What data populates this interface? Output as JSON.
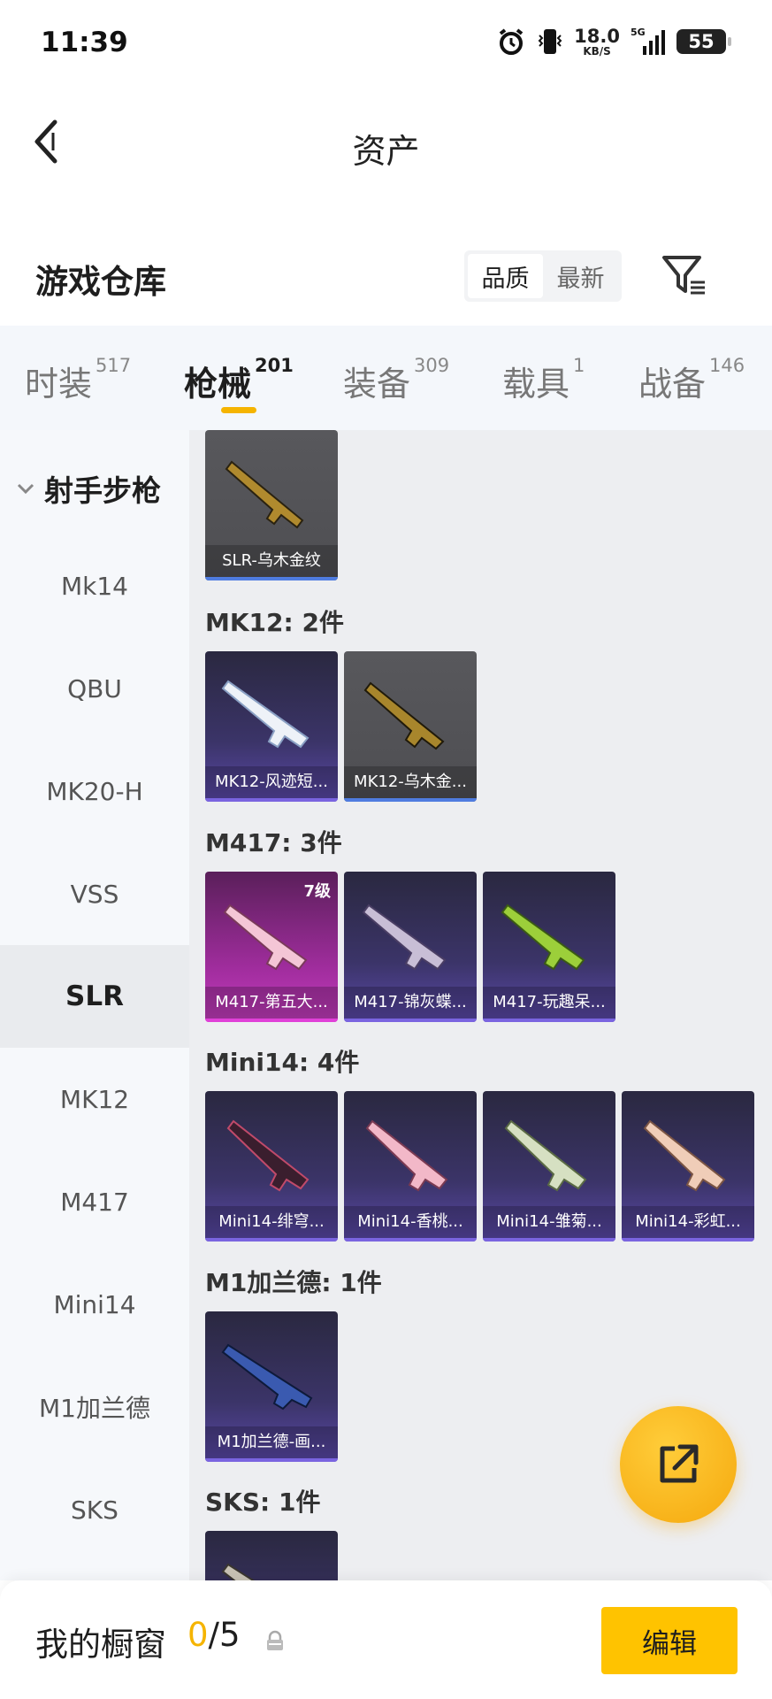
{
  "status_bar": {
    "time": "11:39",
    "net_speed": "18.0",
    "net_speed_unit": "KB/S",
    "net_type": "5G",
    "battery": "55"
  },
  "header": {
    "title": "资产"
  },
  "section": {
    "title": "游戏仓库",
    "sort_options": [
      "品质",
      "最新"
    ],
    "active_sort": "品质"
  },
  "tabs": [
    {
      "name": "时装",
      "count": "517"
    },
    {
      "name": "枪械",
      "count": "201",
      "active": true
    },
    {
      "name": "装备",
      "count": "309"
    },
    {
      "name": "载具",
      "count": "1"
    },
    {
      "name": "战备",
      "count": "146"
    }
  ],
  "sidebar": {
    "group": "射手步枪",
    "items": [
      "Mk14",
      "QBU",
      "MK20-H",
      "VSS",
      "SLR",
      "MK12",
      "M417",
      "Mini14",
      "M1加兰德",
      "SKS"
    ],
    "active": "SLR"
  },
  "groups": [
    {
      "title": "",
      "items": [
        {
          "name": "SLR-乌木金纹",
          "rarity": "grey"
        }
      ]
    },
    {
      "title": "MK12: 2件",
      "items": [
        {
          "name": "MK12-风迹短...",
          "rarity": "purple"
        },
        {
          "name": "MK12-乌木金...",
          "rarity": "grey"
        }
      ]
    },
    {
      "title": "M417: 3件",
      "items": [
        {
          "name": "M417-第五大...",
          "rarity": "pink",
          "level": "7级"
        },
        {
          "name": "M417-锦灰蝶...",
          "rarity": "purple"
        },
        {
          "name": "M417-玩趣呆...",
          "rarity": "purple"
        }
      ]
    },
    {
      "title": "Mini14: 4件",
      "items": [
        {
          "name": "Mini14-绯穹...",
          "rarity": "purple"
        },
        {
          "name": "Mini14-香桃...",
          "rarity": "purple"
        },
        {
          "name": "Mini14-雏菊...",
          "rarity": "purple"
        },
        {
          "name": "Mini14-彩虹...",
          "rarity": "purple"
        }
      ]
    },
    {
      "title": "M1加兰德: 1件",
      "items": [
        {
          "name": "M1加兰德-画...",
          "rarity": "purple"
        }
      ]
    },
    {
      "title": "SKS: 1件",
      "items": [
        {
          "name": "",
          "rarity": "purple"
        }
      ]
    }
  ],
  "showcase": {
    "title": "我的橱窗",
    "current": "0",
    "slash": "/",
    "max": "5",
    "edit_label": "编辑"
  },
  "colors": {
    "accent": "#F5B400",
    "edit_button": "#FFC300",
    "fab": "#F5A80D"
  }
}
